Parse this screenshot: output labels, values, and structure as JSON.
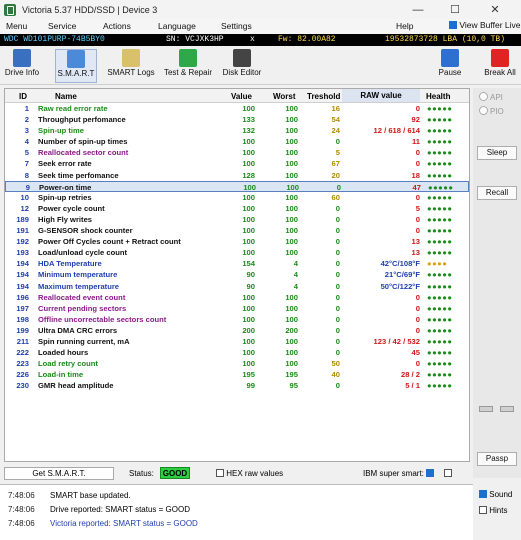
{
  "window": {
    "title": "Victoria 5.37 HDD/SSD | Device 3"
  },
  "menu": [
    "Menu",
    "Service",
    "Actions",
    "Language",
    "Settings",
    "Help"
  ],
  "view_buffer": "View Buffer Live",
  "info": {
    "model": "WDC WD101PURP-74B5BY0",
    "sn": "SN: VCJXK3HP",
    "x": "x",
    "fw": "Fw: 82.00A82",
    "lba": "19532873728 LBA (10,0 TB)"
  },
  "toolbar": [
    "Drive Info",
    "S.M.A.R.T",
    "SMART Logs",
    "Test & Repair",
    "Disk Editor",
    "Pause",
    "Break All"
  ],
  "table": {
    "headers": [
      "ID",
      "Name",
      "Value",
      "Worst",
      "Treshold",
      "RAW value",
      "Health"
    ],
    "rows": [
      {
        "id": "1",
        "name": "Raw read error rate",
        "value": "100",
        "worst": "100",
        "thr": "16",
        "raw": "0",
        "health": "●●●●●",
        "nc": "#1b8a1b",
        "tc": "#1b8a1b",
        "rc": "#d01717",
        "hc": "#1b8a1b"
      },
      {
        "id": "2",
        "name": "Throughput perfomance",
        "value": "133",
        "worst": "100",
        "thr": "54",
        "raw": "92",
        "health": "●●●●●",
        "nc": "#111",
        "tc": "#1b8a1b",
        "rc": "#d01717",
        "hc": "#1b8a1b"
      },
      {
        "id": "3",
        "name": "Spin-up time",
        "value": "132",
        "worst": "100",
        "thr": "24",
        "raw": "12 / 618 / 614",
        "health": "●●●●●",
        "nc": "#1b8a1b",
        "tc": "#1b8a1b",
        "rc": "#d01717",
        "hc": "#1b8a1b"
      },
      {
        "id": "4",
        "name": "Number of spin-up times",
        "value": "100",
        "worst": "100",
        "thr": "0",
        "raw": "11",
        "health": "●●●●●",
        "nc": "#111",
        "tc": "#1b8a1b",
        "rc": "#d01717",
        "hc": "#1b8a1b"
      },
      {
        "id": "5",
        "name": "Reallocated sector count",
        "value": "100",
        "worst": "100",
        "thr": "5",
        "raw": "0",
        "health": "●●●●●",
        "nc": "#8b1a8b",
        "tc": "#1b8a1b",
        "rc": "#d01717",
        "hc": "#1b8a1b"
      },
      {
        "id": "7",
        "name": "Seek error rate",
        "value": "100",
        "worst": "100",
        "thr": "67",
        "raw": "0",
        "health": "●●●●●",
        "nc": "#111",
        "tc": "#1b8a1b",
        "rc": "#d01717",
        "hc": "#1b8a1b"
      },
      {
        "id": "8",
        "name": "Seek time perfomance",
        "value": "128",
        "worst": "100",
        "thr": "20",
        "raw": "18",
        "health": "●●●●●",
        "nc": "#111",
        "tc": "#1b8a1b",
        "rc": "#d01717",
        "hc": "#1b8a1b"
      },
      {
        "id": "9",
        "name": "Power-on time",
        "value": "100",
        "worst": "100",
        "thr": "0",
        "raw": "47",
        "health": "●●●●●",
        "nc": "#111",
        "tc": "#1b8a1b",
        "rc": "#d01717",
        "hc": "#1b8a1b",
        "sel": true
      },
      {
        "id": "10",
        "name": "Spin-up retries",
        "value": "100",
        "worst": "100",
        "thr": "60",
        "raw": "0",
        "health": "●●●●●",
        "nc": "#111",
        "tc": "#1b8a1b",
        "rc": "#d01717",
        "hc": "#1b8a1b"
      },
      {
        "id": "12",
        "name": "Power cycle count",
        "value": "100",
        "worst": "100",
        "thr": "0",
        "raw": "5",
        "health": "●●●●●",
        "nc": "#111",
        "tc": "#1b8a1b",
        "rc": "#d01717",
        "hc": "#1b8a1b"
      },
      {
        "id": "189",
        "name": "High Fly writes",
        "value": "100",
        "worst": "100",
        "thr": "0",
        "raw": "0",
        "health": "●●●●●",
        "nc": "#111",
        "tc": "#1b8a1b",
        "rc": "#d01717",
        "hc": "#1b8a1b"
      },
      {
        "id": "191",
        "name": "G-SENSOR shock counter",
        "value": "100",
        "worst": "100",
        "thr": "0",
        "raw": "0",
        "health": "●●●●●",
        "nc": "#111",
        "tc": "#1b8a1b",
        "rc": "#d01717",
        "hc": "#1b8a1b"
      },
      {
        "id": "192",
        "name": "Power Off Cycles count + Retract count",
        "value": "100",
        "worst": "100",
        "thr": "0",
        "raw": "13",
        "health": "●●●●●",
        "nc": "#111",
        "tc": "#1b8a1b",
        "rc": "#d01717",
        "hc": "#1b8a1b"
      },
      {
        "id": "193",
        "name": "Load/unload cycle count",
        "value": "100",
        "worst": "100",
        "thr": "0",
        "raw": "13",
        "health": "●●●●●",
        "nc": "#111",
        "tc": "#1b8a1b",
        "rc": "#d01717",
        "hc": "#1b8a1b"
      },
      {
        "id": "194",
        "name": "HDA Temperature",
        "value": "154",
        "worst": "4",
        "thr": "0",
        "raw": "42°C/108°F",
        "health": "●●●●",
        "nc": "#1f3fb0",
        "tc": "#1b8a1b",
        "rc": "#1f3fb0",
        "hc": "#e0a100"
      },
      {
        "id": "194",
        "name": "Minimum temperature",
        "value": "90",
        "worst": "4",
        "thr": "0",
        "raw": "21°C/69°F",
        "health": "●●●●●",
        "nc": "#1f3fb0",
        "tc": "#1b8a1b",
        "rc": "#1f3fb0",
        "hc": "#1b8a1b"
      },
      {
        "id": "194",
        "name": "Maximum temperature",
        "value": "90",
        "worst": "4",
        "thr": "0",
        "raw": "50°C/122°F",
        "health": "●●●●●",
        "nc": "#1f3fb0",
        "tc": "#1b8a1b",
        "rc": "#1f3fb0",
        "hc": "#1b8a1b"
      },
      {
        "id": "196",
        "name": "Reallocated event count",
        "value": "100",
        "worst": "100",
        "thr": "0",
        "raw": "0",
        "health": "●●●●●",
        "nc": "#8b1a8b",
        "tc": "#1b8a1b",
        "rc": "#d01717",
        "hc": "#1b8a1b"
      },
      {
        "id": "197",
        "name": "Current pending sectors",
        "value": "100",
        "worst": "100",
        "thr": "0",
        "raw": "0",
        "health": "●●●●●",
        "nc": "#8b1a8b",
        "tc": "#1b8a1b",
        "rc": "#d01717",
        "hc": "#1b8a1b"
      },
      {
        "id": "198",
        "name": "Offline uncorrectable sectors count",
        "value": "100",
        "worst": "100",
        "thr": "0",
        "raw": "0",
        "health": "●●●●●",
        "nc": "#8b1a8b",
        "tc": "#1b8a1b",
        "rc": "#d01717",
        "hc": "#1b8a1b"
      },
      {
        "id": "199",
        "name": "Ultra DMA CRC errors",
        "value": "200",
        "worst": "200",
        "thr": "0",
        "raw": "0",
        "health": "●●●●●",
        "nc": "#111",
        "tc": "#1b8a1b",
        "rc": "#d01717",
        "hc": "#1b8a1b"
      },
      {
        "id": "211",
        "name": "Spin running current, mA",
        "value": "100",
        "worst": "100",
        "thr": "0",
        "raw": "123 / 42 / 532",
        "health": "●●●●●",
        "nc": "#111",
        "tc": "#1b8a1b",
        "rc": "#d01717",
        "hc": "#1b8a1b"
      },
      {
        "id": "222",
        "name": "Loaded hours",
        "value": "100",
        "worst": "100",
        "thr": "0",
        "raw": "45",
        "health": "●●●●●",
        "nc": "#111",
        "tc": "#1b8a1b",
        "rc": "#d01717",
        "hc": "#1b8a1b"
      },
      {
        "id": "223",
        "name": "Load retry count",
        "value": "100",
        "worst": "100",
        "thr": "50",
        "raw": "0",
        "health": "●●●●●",
        "nc": "#1b8a1b",
        "tc": "#1b8a1b",
        "rc": "#d01717",
        "hc": "#1b8a1b"
      },
      {
        "id": "226",
        "name": "Load-in time",
        "value": "195",
        "worst": "195",
        "thr": "40",
        "raw": "28 / 2",
        "health": "●●●●●",
        "nc": "#1b8a1b",
        "tc": "#1b8a1b",
        "rc": "#d01717",
        "hc": "#1b8a1b"
      },
      {
        "id": "230",
        "name": "GMR head amplitude",
        "value": "99",
        "worst": "95",
        "thr": "0",
        "raw": "5 / 1",
        "health": "●●●●●",
        "nc": "#111",
        "tc": "#1b8a1b",
        "rc": "#d01717",
        "hc": "#1b8a1b"
      }
    ]
  },
  "right": {
    "api": "API",
    "pio": "PIO",
    "sleep": "Sleep",
    "recall": "Recall",
    "passp": "Passp"
  },
  "bottom": {
    "get_smart": "Get S.M.A.R.T.",
    "status_label": "Status:",
    "status_value": "GOOD",
    "hex": "HEX raw values",
    "ibm": "IBM super smart:"
  },
  "log": [
    {
      "t": "7:48:06",
      "m": "SMART base updated.",
      "c": "#222"
    },
    {
      "t": "7:48:06",
      "m": "Drive reported: SMART status = GOOD",
      "c": "#222"
    },
    {
      "t": "7:48:06",
      "m": "Victoria reported: SMART status = GOOD",
      "c": "#1f3fb0"
    }
  ],
  "sound": "Sound",
  "hints": "Hints"
}
